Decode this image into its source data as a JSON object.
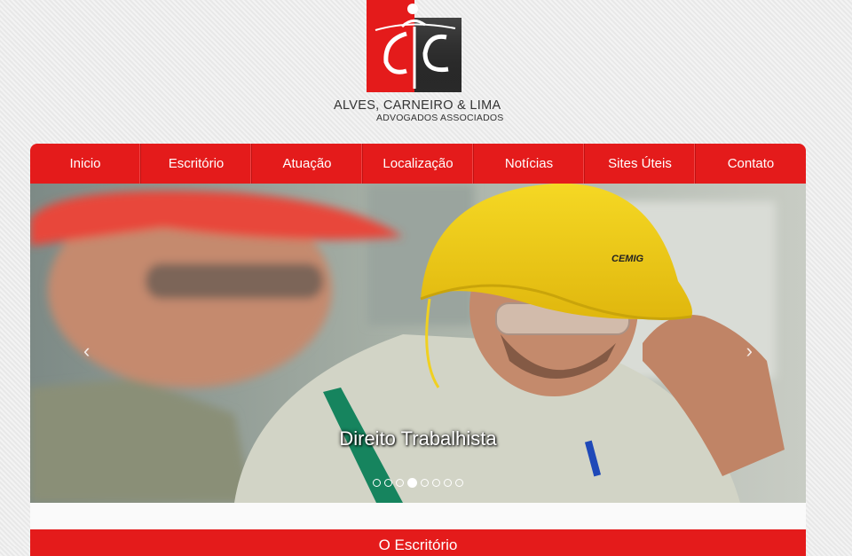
{
  "logo": {
    "name": "ALVES, CARNEIRO & LIMA",
    "subtitle": "ADVOGADOS ASSOCIADOS",
    "helmet_text": "CEMIG"
  },
  "nav": {
    "items": [
      {
        "label": "Inicio"
      },
      {
        "label": "Escritório"
      },
      {
        "label": "Atuação"
      },
      {
        "label": "Localização"
      },
      {
        "label": "Notícias"
      },
      {
        "label": "Sites Úteis"
      },
      {
        "label": "Contato"
      }
    ]
  },
  "slider": {
    "caption": "Direito Trabalhista",
    "prev_label": "‹",
    "next_label": "›",
    "slide_count": 8,
    "active_index": 3
  },
  "section": {
    "title": "O Escritório"
  },
  "colors": {
    "brand_red": "#e41b1b",
    "logo_dark": "#2a2a2a"
  }
}
